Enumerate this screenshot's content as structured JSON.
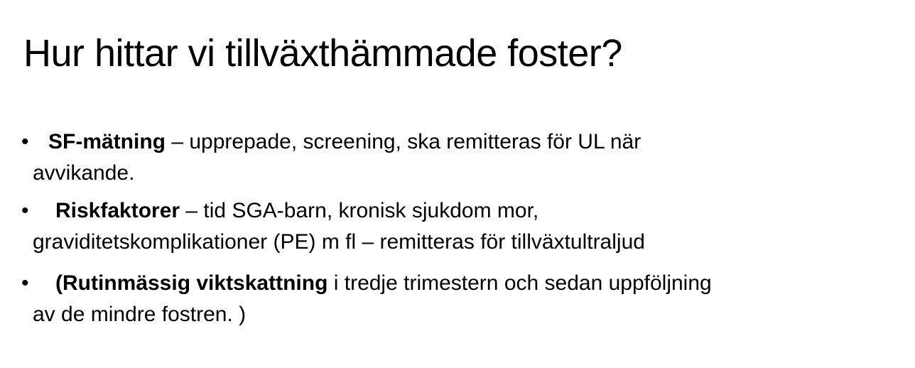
{
  "title": "Hur hittar vi tillväxthämmade foster?",
  "bullets": [
    {
      "bold": "SF-mätning",
      "line1": " – upprepade, screening, ska remitteras för UL när",
      "line2": "avvikande."
    },
    {
      "bold": "Riskfaktorer",
      "line1": " – tid SGA-barn, kronisk sjukdom mor,",
      "line2": "graviditetskomplikationer (PE) m fl – remitteras för tillväxtultraljud"
    },
    {
      "prefix": "(",
      "bold": "Rutinmässig viktskattning",
      "line1": " i tredje trimestern och sedan uppföljning",
      "line2": "av de mindre fostren. )"
    }
  ],
  "bullet_char": "•"
}
